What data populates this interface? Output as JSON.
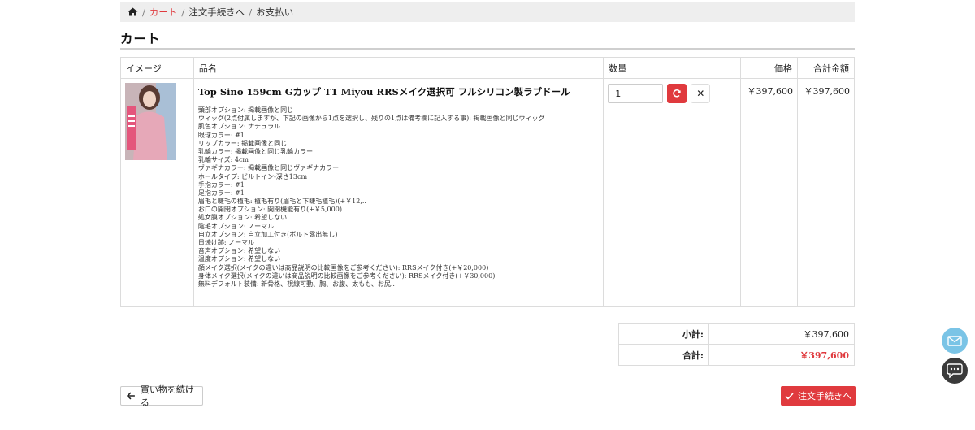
{
  "breadcrumb": {
    "items": [
      "カート",
      "注文手続きへ",
      "お支払い"
    ]
  },
  "page_title": "カート",
  "table": {
    "headers": {
      "image": "イメージ",
      "name": "品名",
      "qty": "数量",
      "price": "価格",
      "total": "合計金額"
    }
  },
  "item": {
    "name": "Top Sino 159cm Gカップ T1 Miyou RRSメイク選択可 フルシリコン製ラブドール",
    "options": [
      "頭部オプション: 掲載画像と同じ",
      "ウィッグ(2点付属しますが、下記の画像から1点を選択し、残りの1点は備考欄に記入する事): 掲載画像と同じウィッグ",
      "肌色オプション: ナチュラル",
      "眼球カラー: #1",
      "リップカラー: 掲載画像と同じ",
      "乳輪カラー: 掲載画像と同じ乳輪カラー",
      "乳輪サイズ: 4cm",
      "ヴァギナカラー: 掲載画像と同じヴァギナカラー",
      "ホールタイプ: ビルトイン-深さ13cm",
      "手指カラー: #1",
      "足指カラー: #1",
      "眉毛と睫毛の植毛: 植毛有り(眉毛と下睫毛植毛)(+￥12,..",
      "お口の開閉オプション: 開閉機能有り(+￥5,000)",
      "処女膜オプション: 希望しない",
      "陰毛オプション: ノーマル",
      "自立オプション: 自立加工付き(ボルト露出無し)",
      "日焼け跡: ノーマル",
      "音声オプション: 希望しない",
      "温度オプション: 希望しない",
      "顔メイク選択(メイクの違いは商品説明の比較画像をご参考ください): RRSメイク付き(+￥20,000)",
      "身体メイク選択(メイクの違いは商品説明の比較画像をご参考ください): RRSメイク付き(+￥30,000)",
      "無料デフォルト装備: 新骨格、視線可動、胸、お腹、太もも、お尻.."
    ],
    "quantity": "1",
    "price": "￥397,600",
    "total": "￥397,600"
  },
  "totals": {
    "subtotal_label": "小計:",
    "subtotal_value": "￥397,600",
    "grand_label": "合計:",
    "grand_value": "￥397,600"
  },
  "buttons": {
    "continue": "買い物を続ける",
    "checkout": "注文手続きへ"
  },
  "colors": {
    "accent": "#e03a3e",
    "mail": "#7ac4e6",
    "chat": "#3a3a3a"
  },
  "icons": {
    "home": "home-icon",
    "refresh": "refresh-icon",
    "remove": "close-icon",
    "back": "arrow-left-icon",
    "check": "check-icon",
    "mail": "mail-icon",
    "chat": "chat-icon"
  }
}
